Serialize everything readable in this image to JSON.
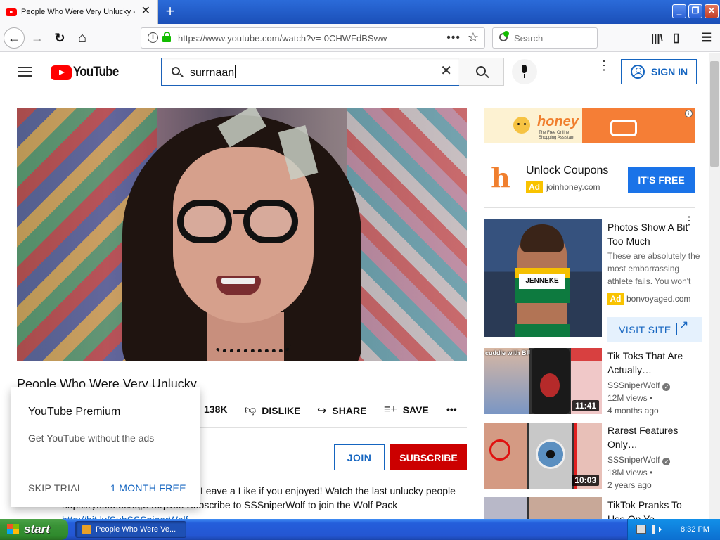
{
  "browser": {
    "tab_title": "People Who Were Very Unlucky - YouTube",
    "tab_close": "✕",
    "new_tab": "+",
    "url": "https://www.youtube.com/watch?v=-0CHWFdBSww",
    "url_more": "•••",
    "url_star": "☆",
    "search_placeholder": "Search",
    "back": "←",
    "forward": "→",
    "reload": "↻",
    "home": "⌂",
    "library": "|||\\",
    "sidebar": "▯",
    "menu": "☰",
    "window_controls": {
      "minimize": "_",
      "maximize": "❐",
      "close": "✕"
    }
  },
  "youtube": {
    "logo_text": "YouTube",
    "search_query": "surrnaan",
    "search_clear": "✕",
    "more": "⋮",
    "sign_in": "SIGN IN",
    "video": {
      "title": "People Who Were Very Unlucky",
      "like_count": "138K",
      "dislike": "DISLIKE",
      "share": "SHARE",
      "save": "SAVE",
      "more": "•••",
      "join": "JOIN",
      "subscribe": "SUBSCRIBE",
      "description": [
        "Leave a Like if you enjoyed! Watch the last unlucky people",
        "https://youtu.be/fqjUTorjObo Subscribe to SSSniperWolf to join the Wolf Pack",
        "http://bit.ly/SubSSSniperWolf"
      ]
    },
    "premium_popup": {
      "title": "YouTube Premium",
      "subtitle": "Get YouTube without the ads",
      "skip": "SKIP TRIAL",
      "trial": "1 MONTH FREE"
    },
    "ad": {
      "banner_brand": "honey",
      "banner_tagline": "The Free Online Shopping Assistant",
      "banner_info": "i",
      "logo_letter": "h",
      "title": "Unlock Coupons",
      "badge": "Ad",
      "domain": "joinhoney.com",
      "cta": "IT'S FREE"
    },
    "sponsored": {
      "bib": "JENNEKE",
      "title": "Photos Show A Bit Too Much",
      "description": "These are absolutely the most embarrassing athlete fails. You won't believe it",
      "badge": "Ad",
      "domain": "bonvoyaged.com",
      "more": "⋮",
      "cta": "VISIT SITE"
    },
    "recommended": [
      {
        "title": "Tik Toks That Are Actually…",
        "channel": "SSSniperWolf",
        "views": "12M views •",
        "age": "4 months ago",
        "duration": "11:41",
        "thumb_label": "cuddle with BF"
      },
      {
        "title": "Rarest Features Only…",
        "channel": "SSSniperWolf",
        "views": "18M views •",
        "age": "2 years ago",
        "duration": "10:03"
      },
      {
        "title": "TikTok Pranks To Use On Yo…"
      }
    ]
  },
  "taskbar": {
    "start": "start",
    "task_item": "People Who Were Ve...",
    "clock": "8:32 PM"
  }
}
